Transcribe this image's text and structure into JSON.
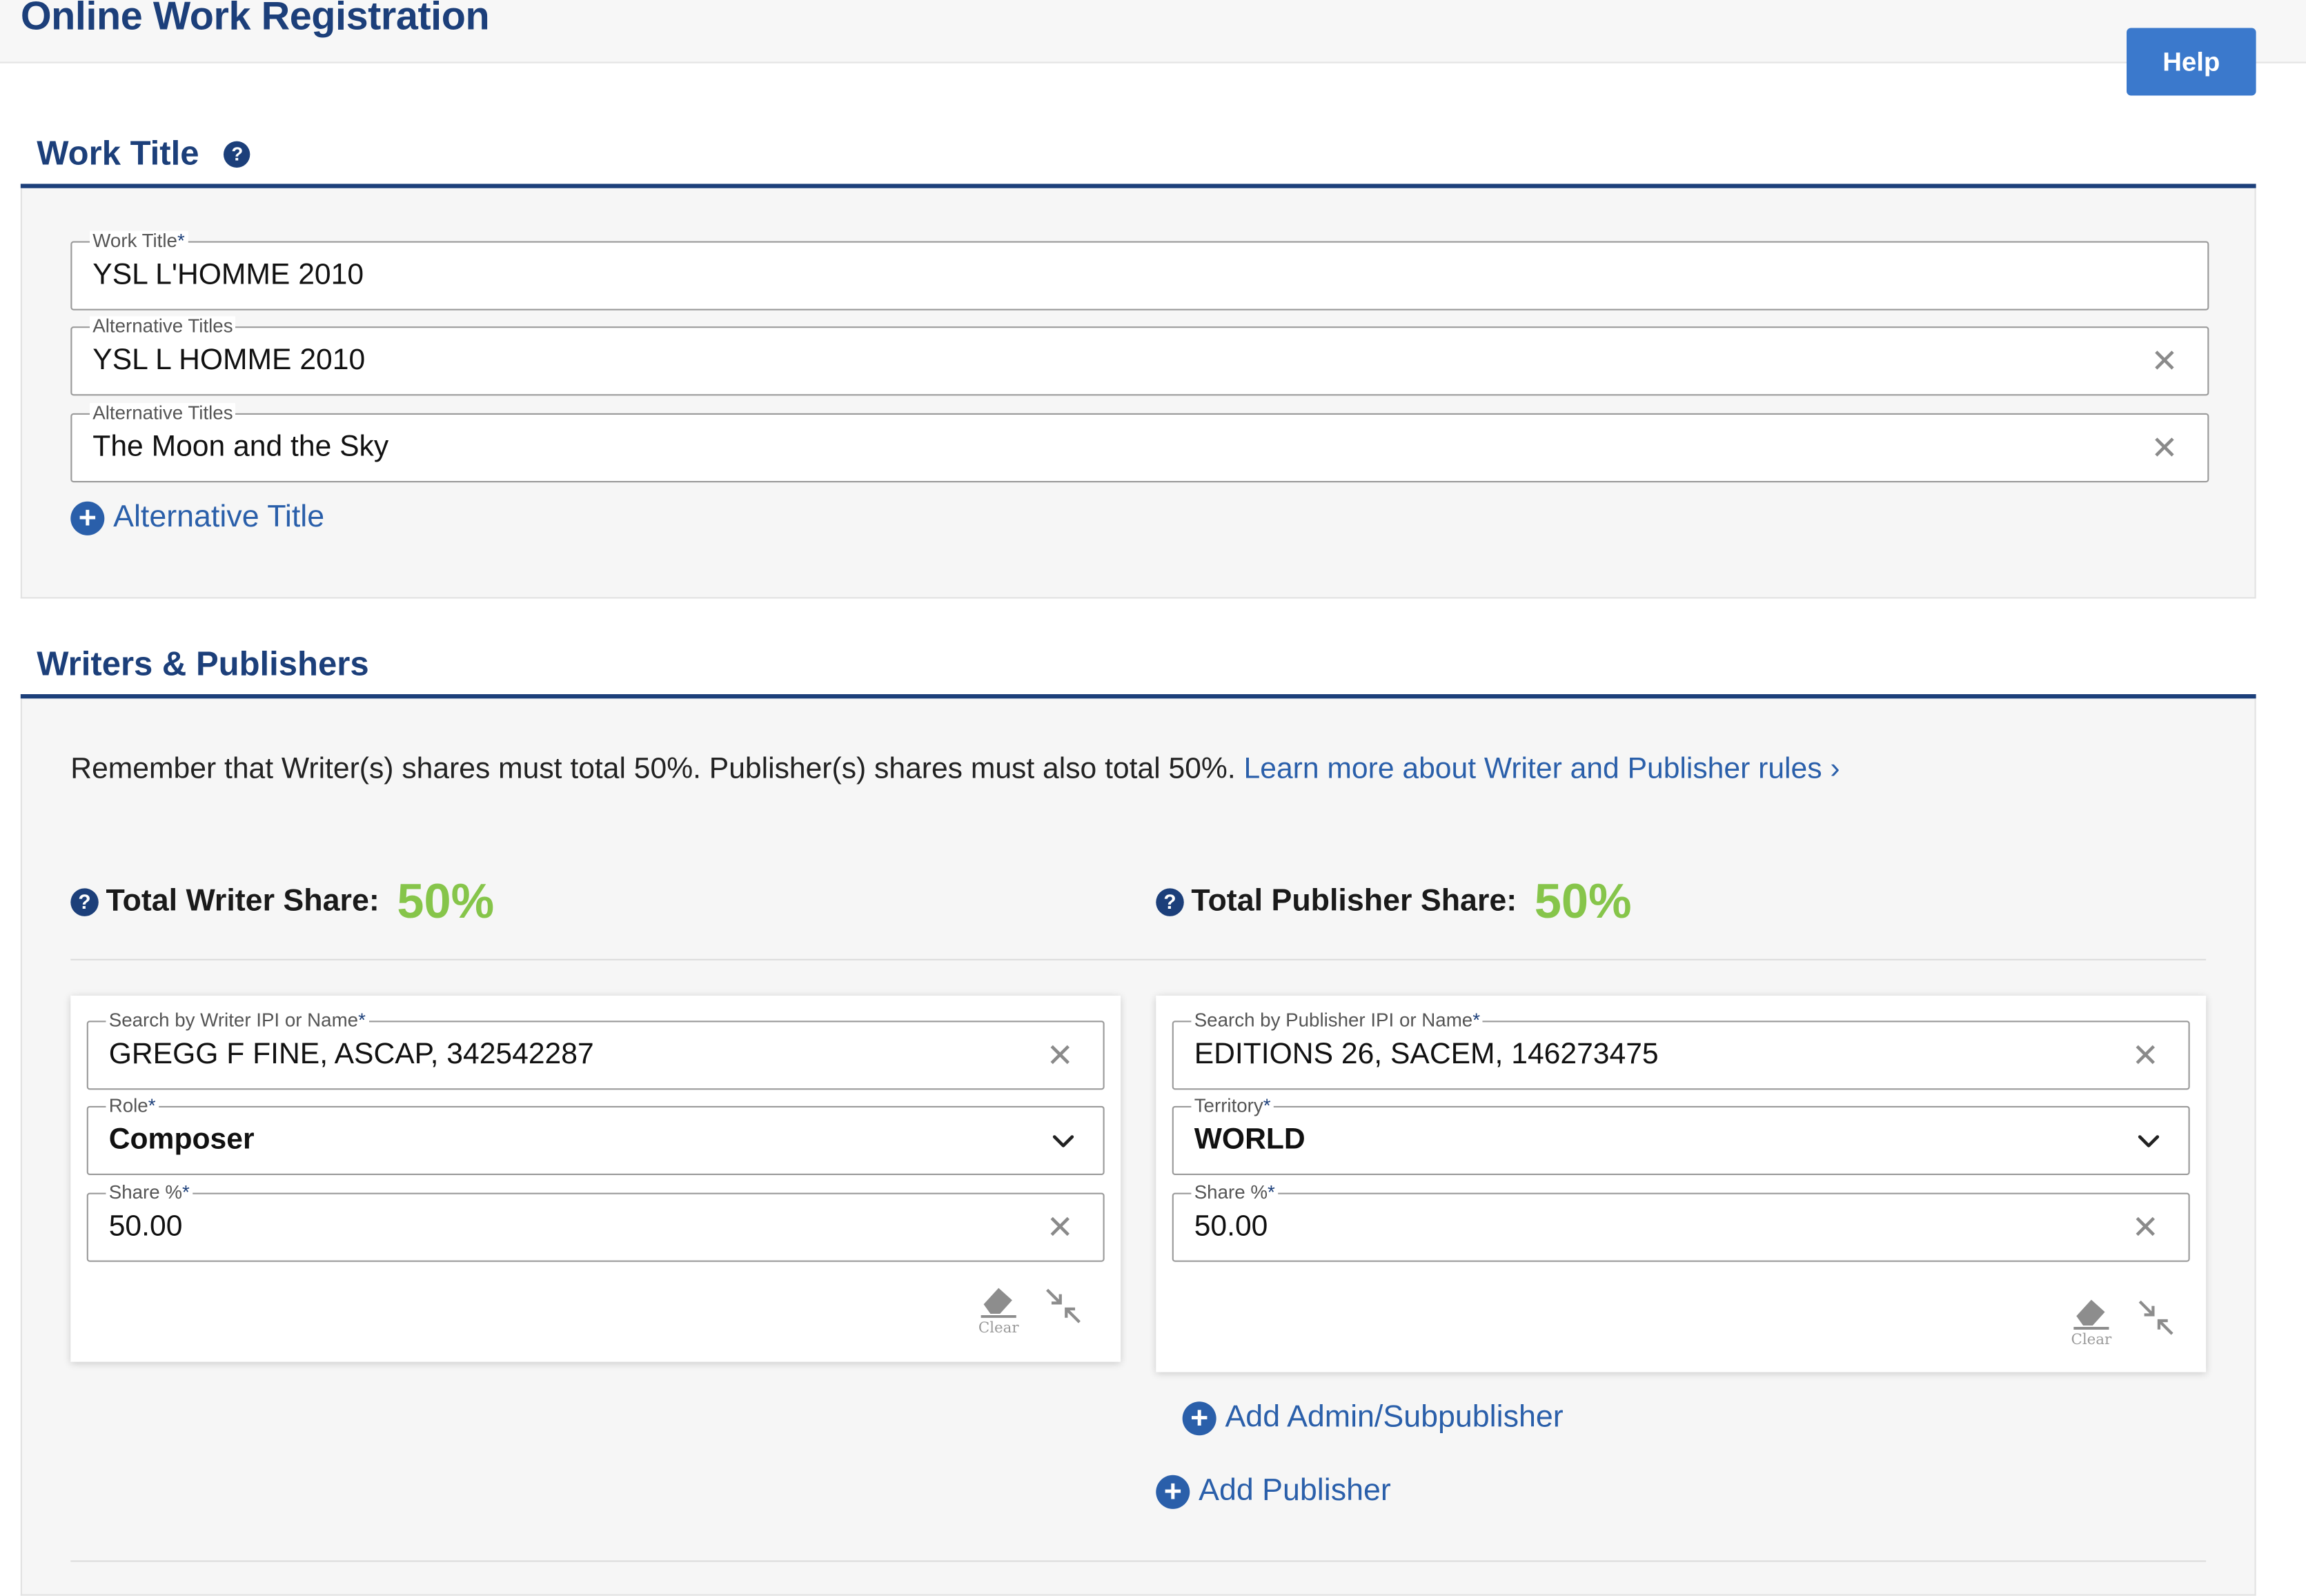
{
  "app": {
    "title": "Online Work Registration",
    "help_label": "Help"
  },
  "work_title_section": {
    "heading": "Work Title",
    "work_title": {
      "label": "Work Title",
      "value": "YSL L'HOMME 2010"
    },
    "alternative_titles": [
      {
        "label": "Alternative Titles",
        "value": "YSL L HOMME 2010"
      },
      {
        "label": "Alternative Titles",
        "value": "The Moon and the Sky"
      }
    ],
    "add_alt_title_label": "Alternative Title"
  },
  "writers_publishers_section": {
    "heading": "Writers & Publishers",
    "notice_text": "Remember that Writer(s) shares must total 50%. Publisher(s) shares must also total 50%.",
    "notice_link": "Learn more about Writer and Publisher rules ›",
    "total_writer": {
      "label": "Total Writer Share:",
      "value": "50%"
    },
    "total_publisher": {
      "label": "Total Publisher Share:",
      "value": "50%"
    },
    "writer_card": {
      "search": {
        "label": "Search by Writer IPI or Name",
        "value": "GREGG F FINE, ASCAP, 342542287"
      },
      "role": {
        "label": "Role",
        "value": "Composer"
      },
      "share": {
        "label": "Share %",
        "value": "50.00"
      },
      "clear_caption": "Clear"
    },
    "publisher_card": {
      "search": {
        "label": "Search by Publisher IPI or Name",
        "value": "EDITIONS 26, SACEM, 146273475"
      },
      "territory": {
        "label": "Territory",
        "value": "WORLD"
      },
      "share": {
        "label": "Share %",
        "value": "50.00"
      },
      "clear_caption": "Clear"
    },
    "add_admin_label": "Add Admin/Subpublisher",
    "add_publisher_label": "Add Publisher"
  },
  "colors": {
    "brand_navy": "#1c3f7a",
    "link_blue": "#2a5faa",
    "button_blue": "#3b79cc",
    "share_green": "#86c54a"
  },
  "icons": [
    "help-circle-icon",
    "plus-circle-icon",
    "clear-x-icon",
    "chevron-down-icon",
    "eraser-icon",
    "collapse-arrows-icon"
  ]
}
